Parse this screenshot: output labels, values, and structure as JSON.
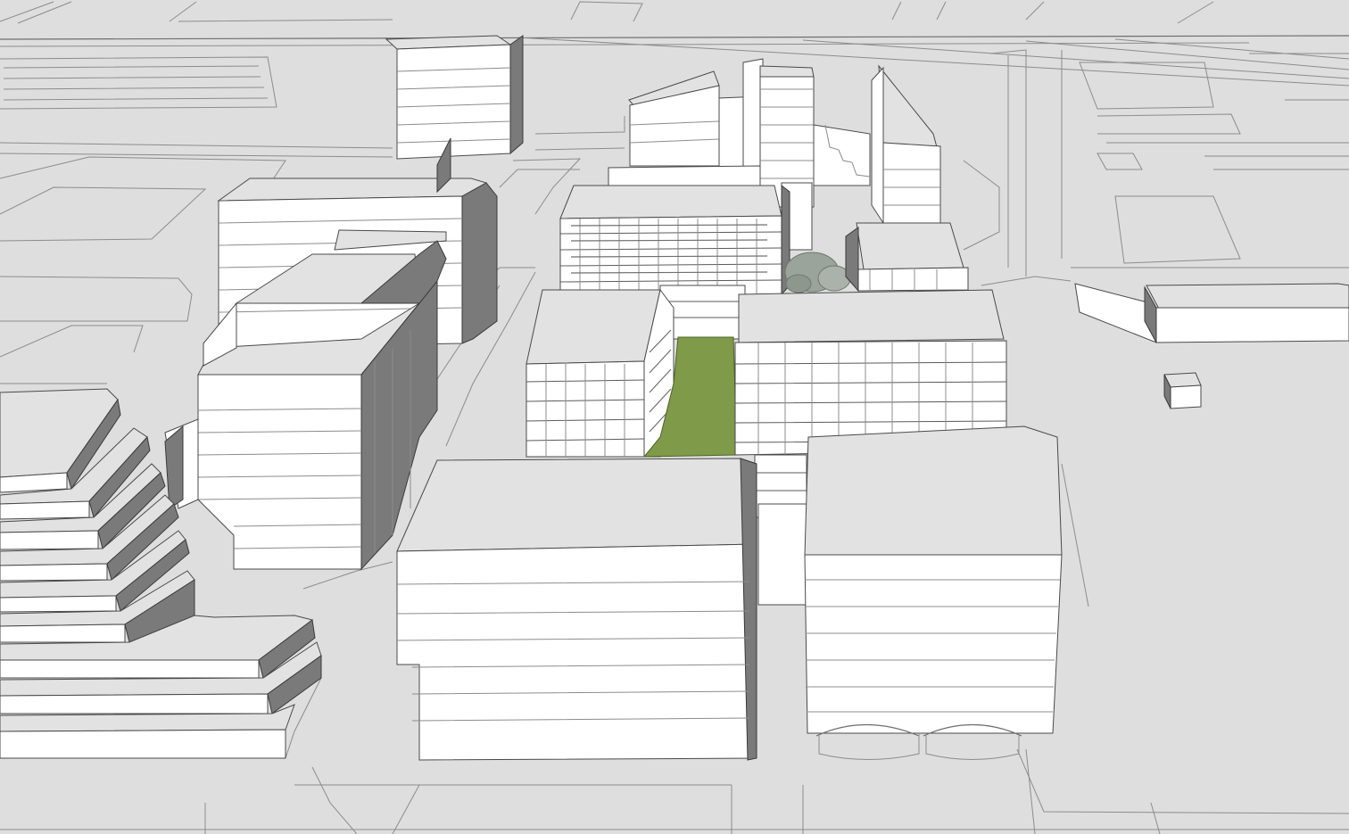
{
  "scene": {
    "kind": "3d-massing-model",
    "colors": {
      "ground": "#dedede",
      "roof": "#e2e2e2",
      "facade": "#ffffff",
      "shadow": "#7a7a7a",
      "edge": "#4a4a4a",
      "courtyard": "#7f9a48",
      "tree": "#9aa49a"
    }
  }
}
